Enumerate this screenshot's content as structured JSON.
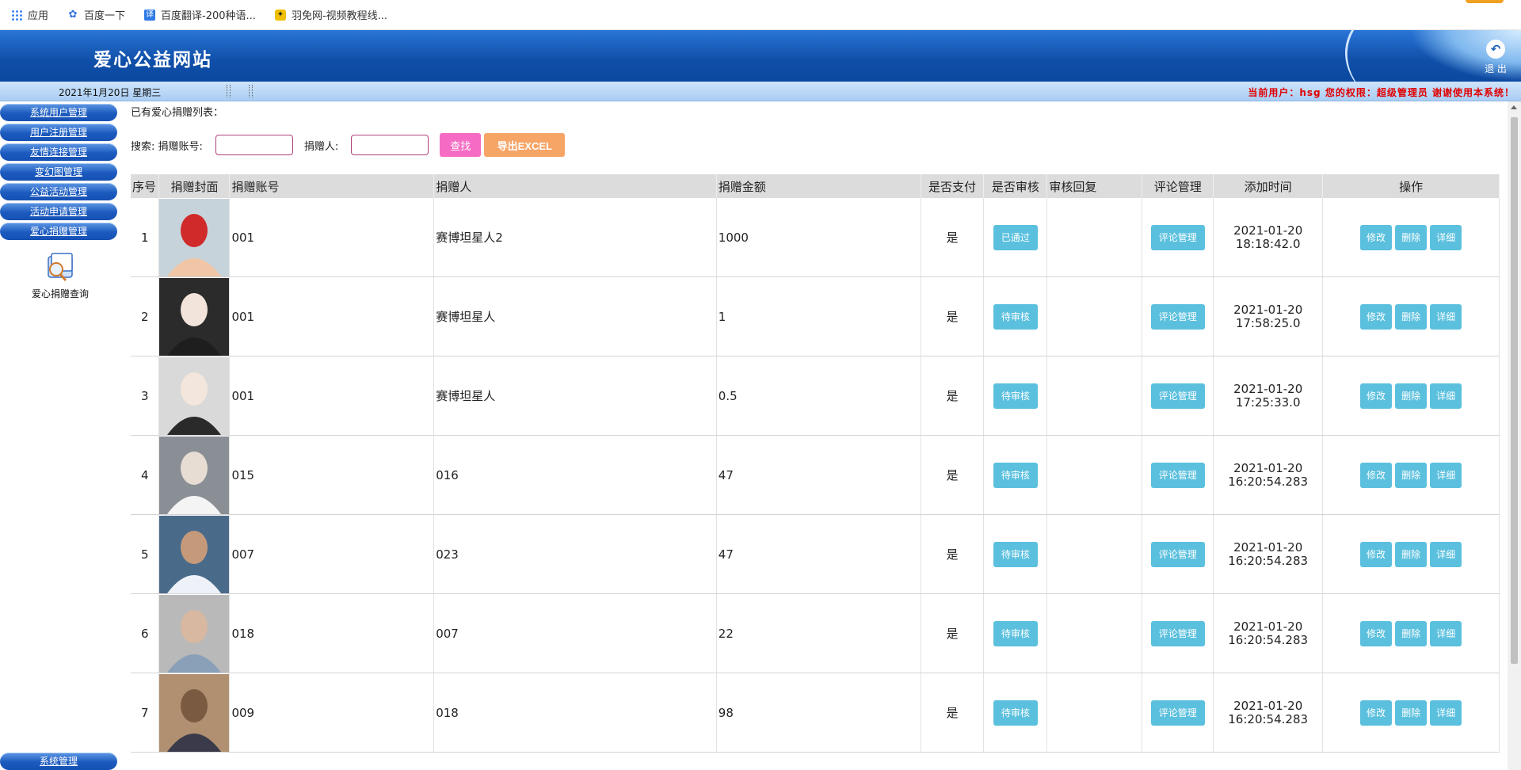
{
  "bookmarks": [
    {
      "icon": "apps-grid-icon",
      "label": "应用"
    },
    {
      "icon": "baidu-paw-icon",
      "label": "百度一下"
    },
    {
      "icon": "fanyi-icon",
      "label": "百度翻译-200种语..."
    },
    {
      "icon": "yumian-icon",
      "label": "羽免网-视频教程线..."
    }
  ],
  "header": {
    "title": "爱心公益网站",
    "logout_label": "退 出"
  },
  "infobar": {
    "date": "2021年1月20日 星期三",
    "user_info": "当前用户：hsg 您的权限：超级管理员 谢谢使用本系统！"
  },
  "sidebar": {
    "menu": [
      "系统用户管理",
      "用户注册管理",
      "友情连接管理",
      "变幻图管理",
      "公益活动管理",
      "活动申请管理",
      "爱心捐赠管理"
    ],
    "current_icon": "donation-search-icon",
    "current_label": "爱心捐赠查询",
    "bottom_menu": "系统管理"
  },
  "main": {
    "list_title": "已有爱心捐赠列表：",
    "search": {
      "prefix": "搜索: 捐赠账号:",
      "donor_label": "捐赠人:",
      "account_value": "",
      "donor_value": "",
      "find_button": "查找",
      "excel_button": "导出EXCEL"
    },
    "table": {
      "headers": [
        "序号",
        "捐赠封面",
        "捐赠账号",
        "捐赠人",
        "捐赠金额",
        "是否支付",
        "是否审核",
        "审核回复",
        "评论管理",
        "添加时间",
        "操作"
      ],
      "rows": [
        {
          "no": "1",
          "account": "001",
          "donor": "赛博坦星人2",
          "amount": "1000",
          "paid": "是",
          "status": "已通过",
          "reply": "",
          "comment": "评论管理",
          "date": "2021-01-20",
          "time": "18:18:42.0",
          "photo": "red-volunteer"
        },
        {
          "no": "2",
          "account": "001",
          "donor": "赛博坦星人",
          "amount": "1",
          "paid": "是",
          "status": "待审核",
          "reply": "",
          "comment": "评论管理",
          "date": "2021-01-20",
          "time": "17:58:25.0",
          "photo": "young-man-car"
        },
        {
          "no": "3",
          "account": "001",
          "donor": "赛博坦星人",
          "amount": "0.5",
          "paid": "是",
          "status": "待审核",
          "reply": "",
          "comment": "评论管理",
          "date": "2021-01-20",
          "time": "17:25:33.0",
          "photo": "young-man-white"
        },
        {
          "no": "4",
          "account": "015",
          "donor": "016",
          "amount": "47",
          "paid": "是",
          "status": "待审核",
          "reply": "",
          "comment": "评论管理",
          "date": "2021-01-20",
          "time": "16:20:54.283",
          "photo": "elderly-man-reading"
        },
        {
          "no": "5",
          "account": "007",
          "donor": "023",
          "amount": "47",
          "paid": "是",
          "status": "待审核",
          "reply": "",
          "comment": "评论管理",
          "date": "2021-01-20",
          "time": "16:20:54.283",
          "photo": "elderly-woman-smiling"
        },
        {
          "no": "6",
          "account": "018",
          "donor": "007",
          "amount": "22",
          "paid": "是",
          "status": "待审核",
          "reply": "",
          "comment": "评论管理",
          "date": "2021-01-20",
          "time": "16:20:54.283",
          "photo": "elderly-man-portrait"
        },
        {
          "no": "7",
          "account": "009",
          "donor": "018",
          "amount": "98",
          "paid": "是",
          "status": "待审核",
          "reply": "",
          "comment": "评论管理",
          "date": "2021-01-20",
          "time": "16:20:54.283",
          "photo": "elderly-man-hat"
        }
      ],
      "actions": [
        "修改",
        "删除",
        "详细"
      ]
    }
  },
  "colors": {
    "header_blue": "#0f4fa8",
    "info_red": "#e00000",
    "action_blue": "#5bc0de",
    "find_pink": "#f66cc4",
    "excel_orange": "#f7a467"
  }
}
